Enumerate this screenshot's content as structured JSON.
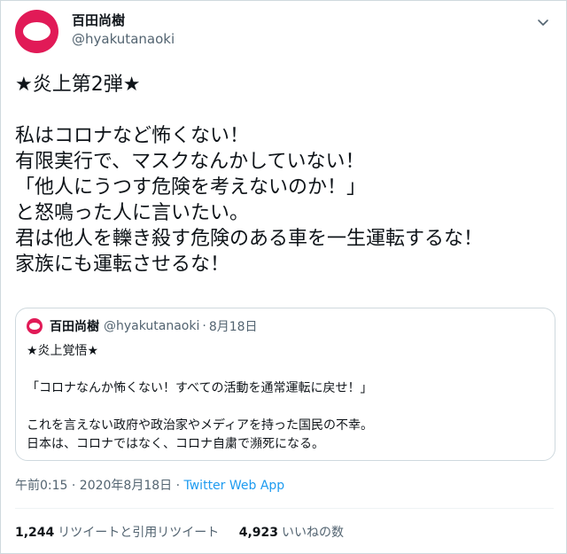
{
  "author": {
    "display_name": "百田尚樹",
    "handle": "@hyakutanaoki",
    "avatar_color": "#e11a57"
  },
  "tweet": {
    "text": "★炎上第2弾★\n\n私はコロナなど怖くない！\n有限実行で、マスクなんかしていない！\n「他人にうつす危険を考えないのか！」\nと怒鳴った人に言いたい。\n君は他人を轢き殺す危険のある車を一生運転するな！\n家族にも運転させるな！"
  },
  "quoted_tweet": {
    "display_name": "百田尚樹",
    "handle": "@hyakutanaoki",
    "separator": "·",
    "date": "8月18日",
    "text": "★炎上覚悟★\n\n「コロナなんか怖くない！すべての活動を通常運転に戻せ！」\n\nこれを言えない政府や政治家やメディアを持った国民の不幸。\n日本は、コロナではなく、コロナ自粛で瀕死になる。"
  },
  "meta": {
    "timestamp": "午前0:15 · 2020年8月18日",
    "separator": " · ",
    "source": "Twitter Web App",
    "link_color": "#1d9bf0"
  },
  "stats": {
    "retweets_count": "1,244",
    "retweets_label": "リツイートと引用リツイート",
    "likes_count": "4,923",
    "likes_label": "いいねの数"
  },
  "icons": {
    "more": "chevron-down-icon"
  }
}
